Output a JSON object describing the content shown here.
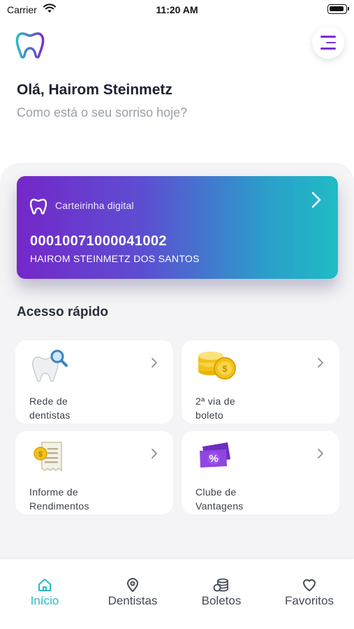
{
  "status_bar": {
    "carrier": "Carrier",
    "time": "11:20 AM"
  },
  "header": {
    "greeting": "Olá, Hairom Steinmetz",
    "subtitle": "Como está o seu sorriso hoje?"
  },
  "card": {
    "label": "Carteirinha digital",
    "number": "00010071000041002",
    "holder": "HAIROM STEINMETZ DOS SANTOS"
  },
  "quick_access": {
    "title": "Acesso rápido",
    "items": [
      {
        "line1": "Rede de",
        "line2": "dentistas",
        "icon": "tooth-search-icon"
      },
      {
        "line1": "2ª via de",
        "line2": "boleto",
        "icon": "coins-icon"
      },
      {
        "line1": "Informe de",
        "line2": "Rendimentos",
        "icon": "receipt-icon"
      },
      {
        "line1": "Clube de",
        "line2": "Vantagens",
        "icon": "discount-ticket-icon"
      }
    ]
  },
  "tabs": [
    {
      "label": "Início",
      "icon": "home-icon",
      "active": true
    },
    {
      "label": "Dentistas",
      "icon": "map-pin-icon",
      "active": false
    },
    {
      "label": "Boletos",
      "icon": "coins-stack-icon",
      "active": false
    },
    {
      "label": "Favoritos",
      "icon": "heart-icon",
      "active": false
    }
  ],
  "colors": {
    "accent": "#2bb8c8",
    "purple": "#7527c9",
    "card_gradient_start": "#7527c9",
    "card_gradient_end": "#1fbcc4"
  }
}
